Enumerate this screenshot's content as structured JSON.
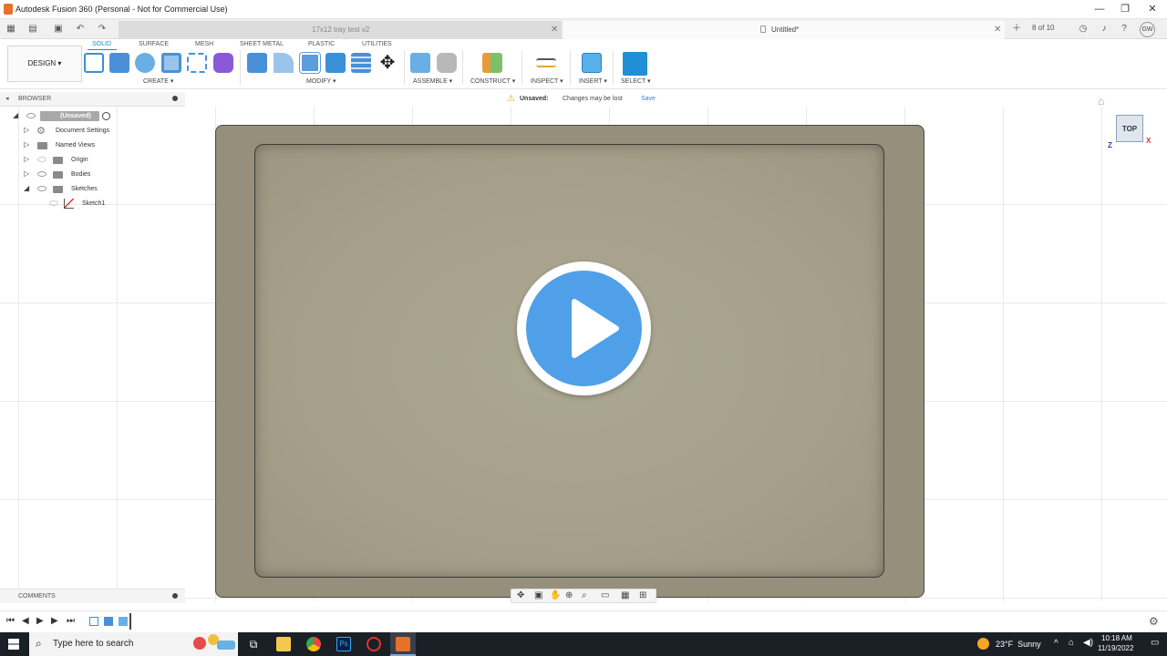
{
  "window": {
    "title": "Autodesk Fusion 360 (Personal - Not for Commercial Use)",
    "minimize": "—",
    "maximize": "❐",
    "close": "✕"
  },
  "tabs": {
    "doc1": "17x12 tray test v2",
    "doc2": "Untitled*",
    "page_count": "8 of 10",
    "user_initials": "GW"
  },
  "ribbon": {
    "design_label": "DESIGN ▾",
    "workspace_tabs": [
      "SOLID",
      "SURFACE",
      "MESH",
      "SHEET METAL",
      "PLASTIC",
      "UTILITIES"
    ],
    "groups": {
      "create": "CREATE ▾",
      "modify": "MODIFY ▾",
      "assemble": "ASSEMBLE ▾",
      "construct": "CONSTRUCT ▾",
      "inspect": "INSPECT ▾",
      "insert": "INSERT ▾",
      "select": "SELECT ▾"
    }
  },
  "unsaved_bar": {
    "label": "Unsaved:",
    "message": "Changes may be lost",
    "save": "Save"
  },
  "browser": {
    "header": "BROWSER",
    "root": "(Unsaved)",
    "items": [
      "Document Settings",
      "Named Views",
      "Origin",
      "Bodies",
      "Sketches",
      "Sketch1"
    ]
  },
  "viewcube": {
    "face": "TOP",
    "axis_x": "X",
    "axis_z": "Z"
  },
  "comments": {
    "label": "COMMENTS"
  },
  "taskbar": {
    "search_placeholder": "Type here to search",
    "weather": "23°F  Sunny",
    "time": "10:18 AM",
    "date": "11/19/2022"
  },
  "colors": {
    "accent": "#1e8bd1",
    "tray_outer": "#958f7c",
    "tray_inner": "#aca792",
    "play_button": "#4fa0e8",
    "taskbar": "#1b1f26"
  }
}
